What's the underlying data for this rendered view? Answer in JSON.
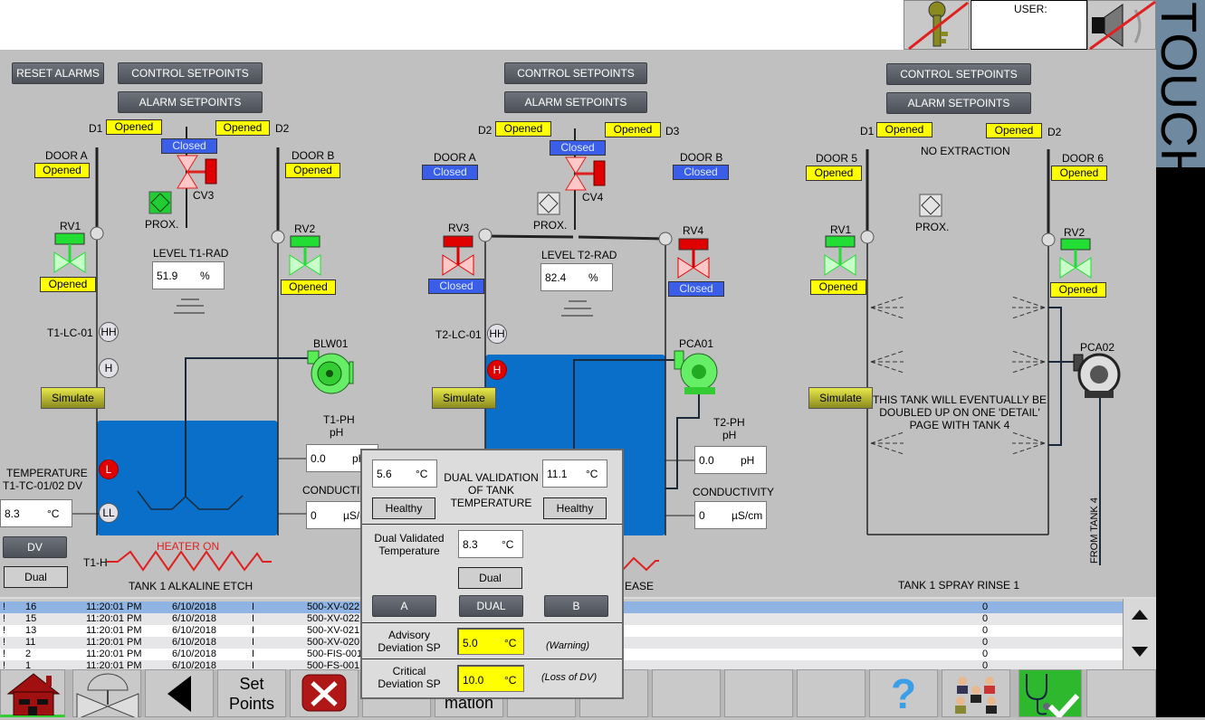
{
  "header": {
    "user_label": "USER:",
    "touch_label": "TOUCH"
  },
  "colors": {
    "opened": "#ffff00",
    "closed": "#3a5ee8",
    "liquid": "#0a6fc8",
    "valve_open": "#22dd33",
    "valve_closed": "#e00000",
    "alarm_active": "#e00000",
    "selected_row": "#8fb4e3"
  },
  "tank1": {
    "reset_alarms": "RESET ALARMS",
    "control_setpoints": "CONTROL SETPOINTS",
    "alarm_setpoints": "ALARM SETPOINTS",
    "d1": "D1",
    "d1_status": "Opened",
    "d2": "D2",
    "d2_status": "Opened",
    "cv_label": "CV3",
    "cv_status": "Closed",
    "prox": "PROX.",
    "door_a": "DOOR A",
    "door_a_status": "Opened",
    "door_b": "DOOR B",
    "door_b_status": "Opened",
    "rv1": "RV1",
    "rv1_status": "Opened",
    "rv2": "RV2",
    "rv2_status": "Opened",
    "level_label": "LEVEL T1-RAD",
    "level_value": "51.9",
    "level_unit": "%",
    "lc": "T1-LC-01",
    "hh": "HH",
    "h": "H",
    "l": "L",
    "ll": "LL",
    "simulate": "Simulate",
    "blower": "BLW01",
    "ph_label": "T1-PH",
    "ph_sub": "pH",
    "ph_value": "0.0",
    "ph_unit": "pH",
    "cond_label": "CONDUCTIVITY",
    "cond_value": "0",
    "cond_unit": "µS/cm",
    "temp_label1": "TEMPERATURE",
    "temp_label2": "T1-TC-01/02 DV",
    "temp_value": "8.3",
    "temp_unit": "°C",
    "dv": "DV",
    "dual": "Dual",
    "heater_status": "HEATER ON",
    "heater_tag": "T1-H",
    "name": "TANK 1 ALKALINE ETCH"
  },
  "tank2": {
    "control_setpoints": "CONTROL SETPOINTS",
    "alarm_setpoints": "ALARM SETPOINTS",
    "d2": "D2",
    "d2_status": "Opened",
    "d3": "D3",
    "d3_status": "Opened",
    "cv_label": "CV4",
    "cv_status": "Closed",
    "prox": "PROX.",
    "door_a": "DOOR A",
    "door_a_status": "Closed",
    "door_b": "DOOR B",
    "door_b_status": "Closed",
    "rv3": "RV3",
    "rv3_status": "Closed",
    "rv4": "RV4",
    "rv4_status": "Closed",
    "level_label": "LEVEL T2-RAD",
    "level_value": "82.4",
    "level_unit": "%",
    "lc": "T2-LC-01",
    "hh": "HH",
    "h": "H",
    "simulate": "Simulate",
    "pump": "PCA01",
    "ph_label": "T2-PH",
    "ph_sub": "pH",
    "ph_value": "0.0",
    "ph_unit": "pH",
    "cond_label": "CONDUCTIVITY",
    "cond_value": "0",
    "cond_unit": "µS/cm",
    "name_visible": "EASE"
  },
  "tank3": {
    "control_setpoints": "CONTROL SETPOINTS",
    "alarm_setpoints": "ALARM SETPOINTS",
    "d1": "D1",
    "d1_status": "Opened",
    "d2": "D2",
    "d2_status": "Opened",
    "no_extraction": "NO EXTRACTION",
    "door5": "DOOR 5",
    "door5_status": "Opened",
    "door6": "DOOR 6",
    "door6_status": "Opened",
    "prox": "PROX.",
    "rv1": "RV1",
    "rv1_status": "Opened",
    "rv2": "RV2",
    "rv2_status": "Opened",
    "simulate": "Simulate",
    "note1": "THIS TANK WILL EVENTUALLY BE",
    "note2": "DOUBLED UP ON ONE 'DETAIL'",
    "note3": "PAGE WITH TANK 4",
    "pump": "PCA02",
    "from_tank": "FROM TANK 4",
    "name": "TANK 1 SPRAY RINSE 1"
  },
  "alarms": {
    "rows": [
      [
        "!",
        "16",
        "11:20:01 PM",
        "6/10/2018",
        "I",
        "500-XV-022",
        "0"
      ],
      [
        "!",
        "15",
        "11:20:01 PM",
        "6/10/2018",
        "I",
        "500-XV-022",
        "0"
      ],
      [
        "!",
        "13",
        "11:20:01 PM",
        "6/10/2018",
        "I",
        "500-XV-021",
        "0"
      ],
      [
        "!",
        "11",
        "11:20:01 PM",
        "6/10/2018",
        "I",
        "500-XV-020",
        "0"
      ],
      [
        "!",
        "2",
        "11:20:01 PM",
        "6/10/2018",
        "I",
        "500-FIS-001",
        "0"
      ],
      [
        "!",
        "1",
        "11:20:01 PM",
        "6/10/2018",
        "I",
        "500-FS-001",
        "0"
      ]
    ],
    "selected": 0
  },
  "toolbar": {
    "setpoints_line1": "Set",
    "setpoints_line2": "Points",
    "info_visible": "mation"
  },
  "popup": {
    "a_value": "5.6",
    "a_unit": "°C",
    "a_status": "Healthy",
    "b_value": "11.1",
    "b_unit": "°C",
    "b_status": "Healthy",
    "title1": "DUAL VALIDATION",
    "title2": "OF TANK",
    "title3": "TEMPERATURE",
    "dv_label1": "Dual Validated",
    "dv_label2": "Temperature",
    "dv_value": "8.3",
    "dv_unit": "°C",
    "mode": "Dual",
    "btn_a": "A",
    "btn_dual": "DUAL",
    "btn_b": "B",
    "adv_label1": "Advisory",
    "adv_label2": "Deviation SP",
    "adv_value": "5.0",
    "adv_unit": "°C",
    "adv_note": "(Warning)",
    "crit_label1": "Critical",
    "crit_label2": "Deviation SP",
    "crit_value": "10.0",
    "crit_unit": "°C",
    "crit_note": "(Loss of DV)"
  }
}
